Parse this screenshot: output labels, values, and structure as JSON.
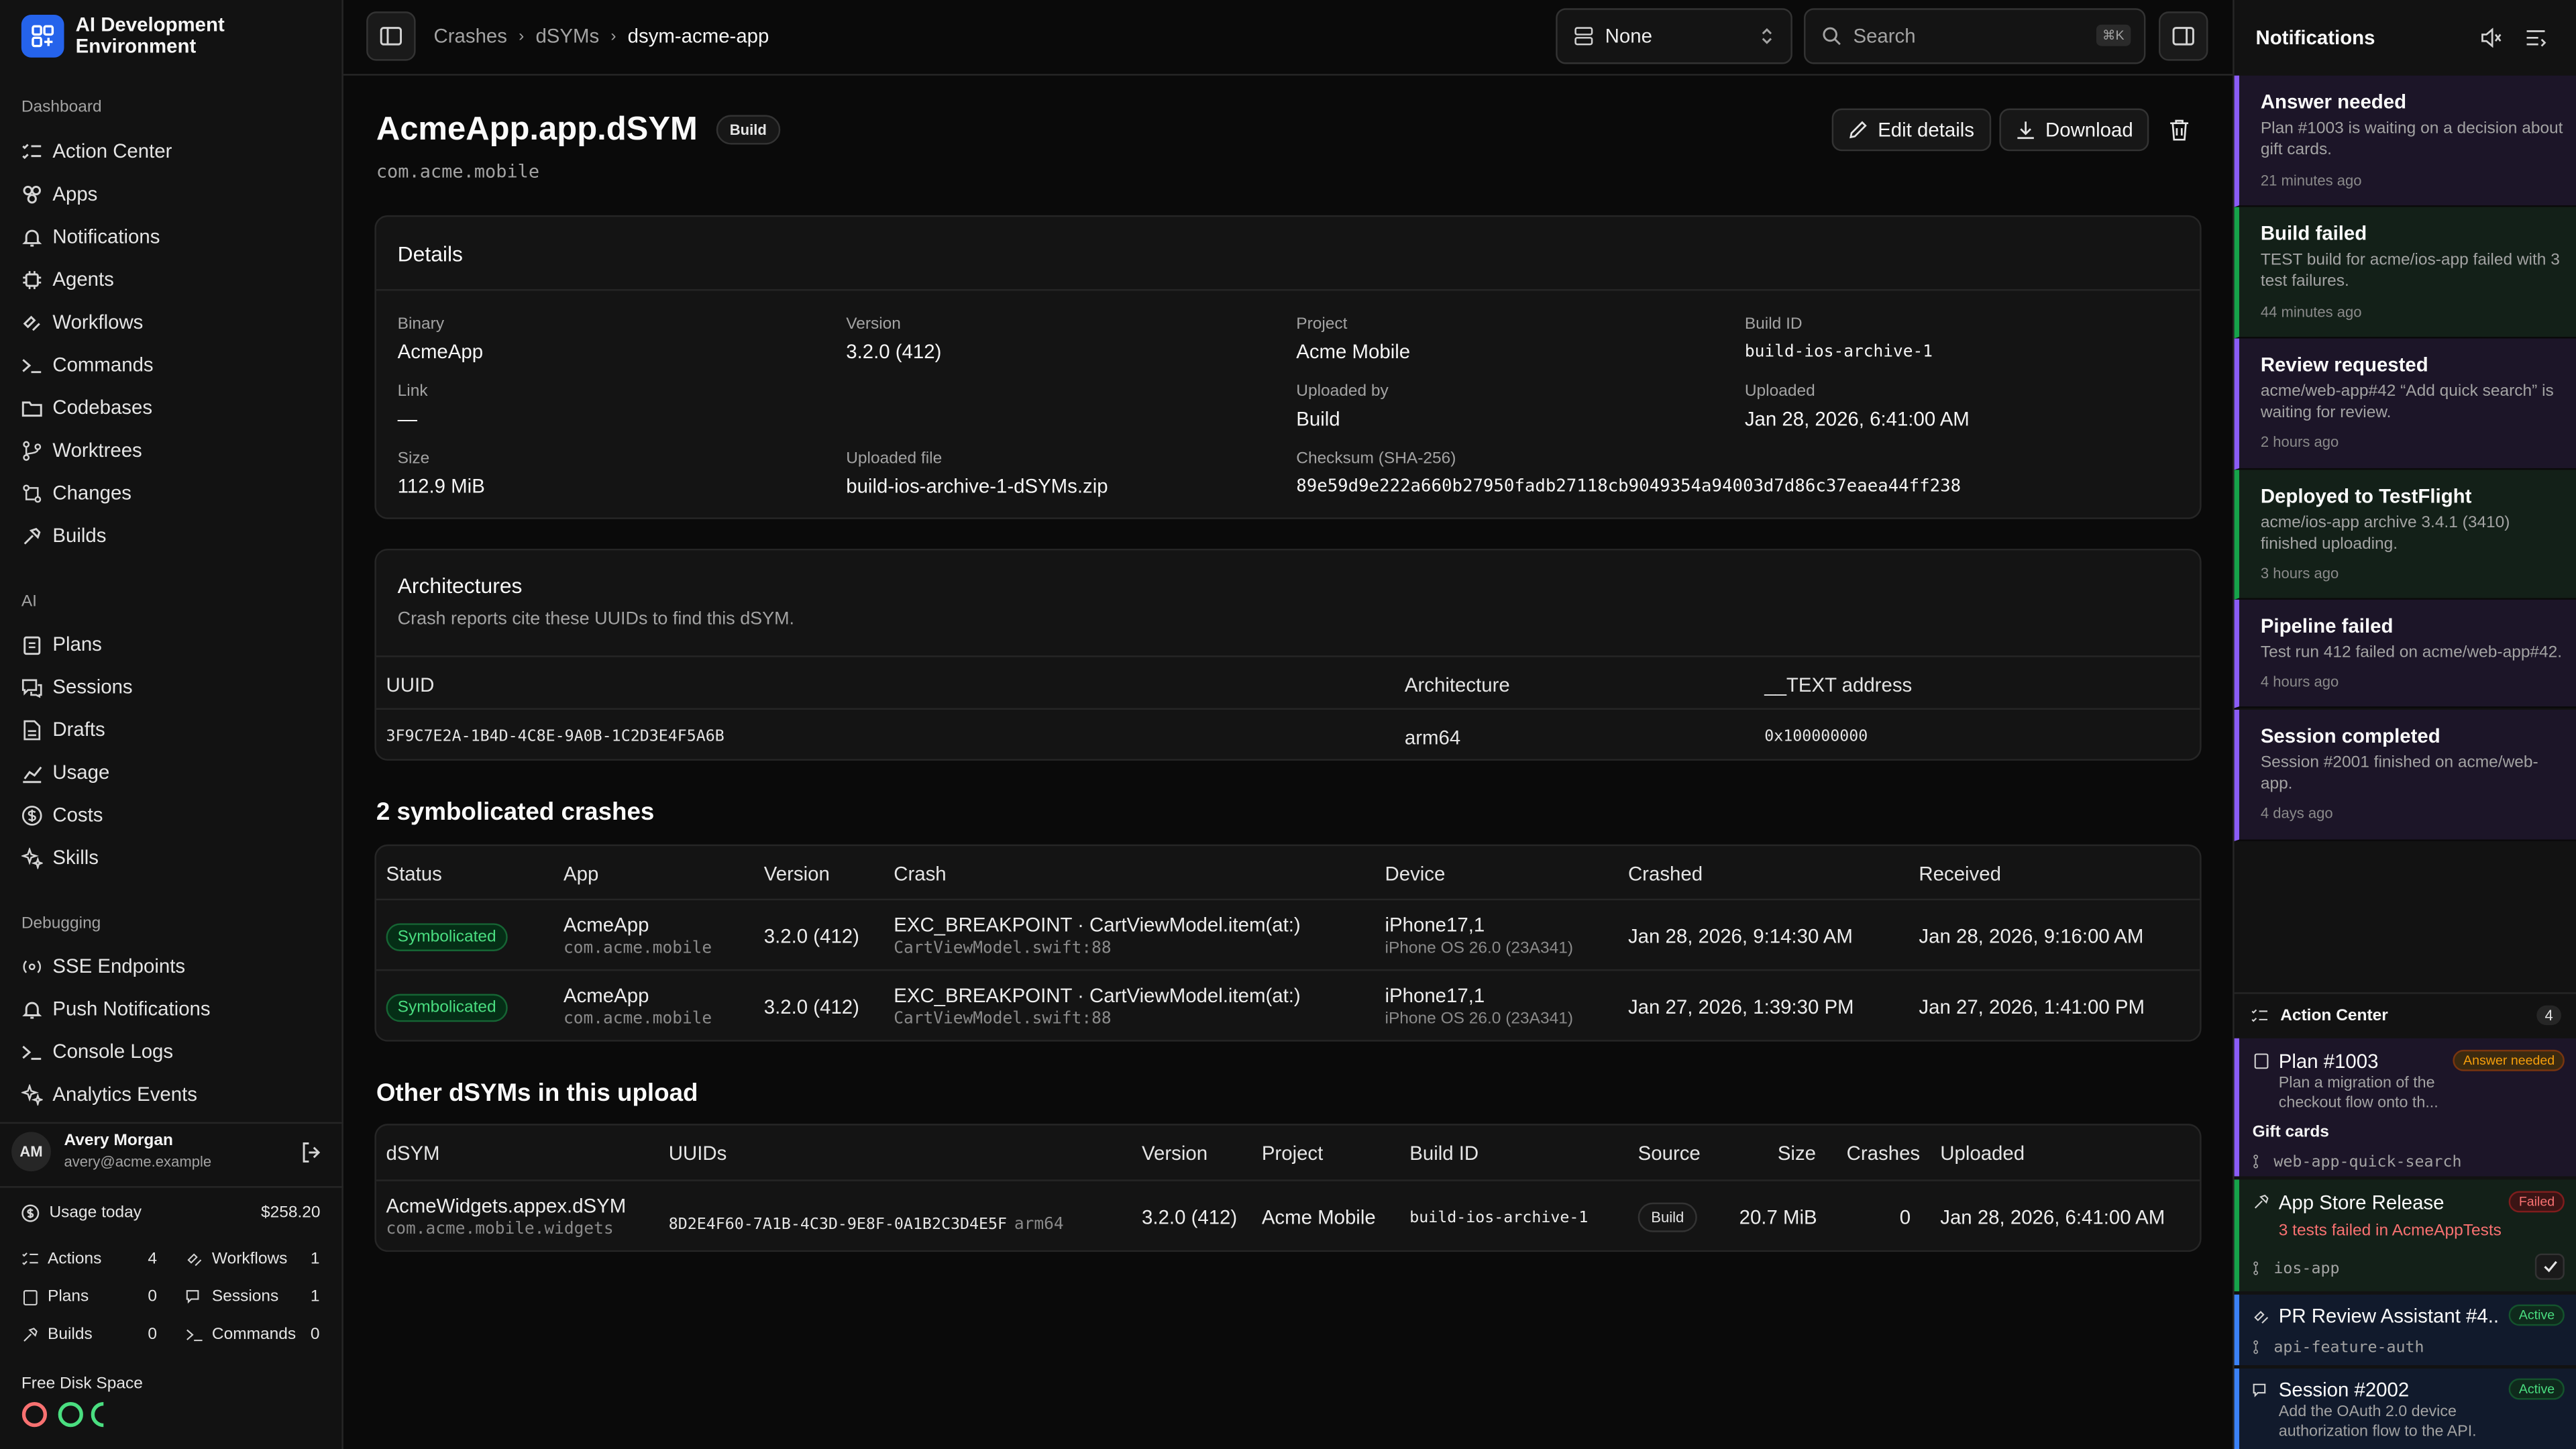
{
  "brand": {
    "line1": "AI Development",
    "line2": "Environment"
  },
  "sidebar": {
    "sections": {
      "dashboard": "Dashboard",
      "ai": "AI",
      "debugging": "Debugging"
    },
    "dashboard_items": [
      "Action Center",
      "Apps",
      "Notifications",
      "Agents",
      "Workflows",
      "Commands",
      "Codebases",
      "Worktrees",
      "Changes",
      "Builds"
    ],
    "ai_items": [
      "Plans",
      "Sessions",
      "Drafts",
      "Usage",
      "Costs",
      "Skills"
    ],
    "debug_items": [
      "SSE Endpoints",
      "Push Notifications",
      "Console Logs",
      "Analytics Events"
    ],
    "user": {
      "initials": "AM",
      "name": "Avery Morgan",
      "email": "avery@acme.example"
    },
    "usage": {
      "label": "Usage today",
      "value": "$258.20"
    },
    "stats": [
      {
        "label": "Actions",
        "value": "4"
      },
      {
        "label": "Workflows",
        "value": "1"
      },
      {
        "label": "Plans",
        "value": "0"
      },
      {
        "label": "Sessions",
        "value": "1"
      },
      {
        "label": "Builds",
        "value": "0"
      },
      {
        "label": "Commands",
        "value": "0"
      }
    ],
    "disk": {
      "label": "Free Disk Space"
    }
  },
  "header": {
    "breadcrumbs": [
      "Crashes",
      "dSYMs",
      "dsym-acme-app"
    ],
    "select_value": "None",
    "search_placeholder": "Search",
    "search_shortcut": "⌘K"
  },
  "page": {
    "title": "AcmeApp.app.dSYM",
    "badge": "Build",
    "subtitle": "com.acme.mobile",
    "edit_label": "Edit details",
    "download_label": "Download"
  },
  "details": {
    "heading": "Details",
    "binary_label": "Binary",
    "binary": "AcmeApp",
    "version_label": "Version",
    "version": "3.2.0 (412)",
    "project_label": "Project",
    "project": "Acme Mobile",
    "build_id_label": "Build ID",
    "build_id": "build-ios-archive-1",
    "link_label": "Link",
    "link": "—",
    "uploaded_by_label": "Uploaded by",
    "uploaded_by": "Build",
    "uploaded_label": "Uploaded",
    "uploaded": "Jan 28, 2026, 6:41:00 AM",
    "size_label": "Size",
    "size": "112.9 MiB",
    "file_label": "Uploaded file",
    "file": "build-ios-archive-1-dSYMs.zip",
    "checksum_label": "Checksum (SHA-256)",
    "checksum": "89e59d9e222a660b27950fadb27118cb9049354a94003d7d86c37eaea44ff238"
  },
  "architectures": {
    "heading": "Architectures",
    "description": "Crash reports cite these UUIDs to find this dSYM.",
    "columns": [
      "UUID",
      "Architecture",
      "__TEXT address"
    ],
    "row": {
      "uuid": "3F9C7E2A-1B4D-4C8E-9A0B-1C2D3E4F5A6B",
      "arch": "arm64",
      "address": "0x100000000"
    }
  },
  "crashes": {
    "heading": "2 symbolicated crashes",
    "columns": [
      "Status",
      "App",
      "Version",
      "Crash",
      "Device",
      "Crashed",
      "Received"
    ],
    "rows": [
      {
        "status": "Symbolicated",
        "app": "AcmeApp",
        "bundle": "com.acme.mobile",
        "version": "3.2.0 (412)",
        "crash": "EXC_BREAKPOINT · CartViewModel.item(at:)",
        "location": "CartViewModel.swift:88",
        "device": "iPhone17,1",
        "os": "iPhone OS 26.0 (23A341)",
        "crashed": "Jan 28, 2026, 9:14:30 AM",
        "received": "Jan 28, 2026, 9:16:00 AM"
      },
      {
        "status": "Symbolicated",
        "app": "AcmeApp",
        "bundle": "com.acme.mobile",
        "version": "3.2.0 (412)",
        "crash": "EXC_BREAKPOINT · CartViewModel.item(at:)",
        "location": "CartViewModel.swift:88",
        "device": "iPhone17,1",
        "os": "iPhone OS 26.0 (23A341)",
        "crashed": "Jan 27, 2026, 1:39:30 PM",
        "received": "Jan 27, 2026, 1:41:00 PM"
      }
    ]
  },
  "others": {
    "heading": "Other dSYMs in this upload",
    "columns": [
      "dSYM",
      "UUIDs",
      "Version",
      "Project",
      "Build ID",
      "Source",
      "Size",
      "Crashes",
      "Uploaded"
    ],
    "row": {
      "name": "AcmeWidgets.appex.dSYM",
      "bundle": "com.acme.mobile.widgets",
      "uuid": "8D2E4F60-7A1B-4C3D-9E8F-0A1B2C3D4E5F",
      "arch": "arm64",
      "version": "3.2.0 (412)",
      "project": "Acme Mobile",
      "build_id": "build-ios-archive-1",
      "source": "Build",
      "size": "20.7 MiB",
      "crashes": "0",
      "uploaded": "Jan 28, 2026, 6:41:00 AM"
    }
  },
  "notifications": {
    "title": "Notifications",
    "items": [
      {
        "title": "Answer needed",
        "body": "Plan #1003 is waiting on a decision about gift cards.",
        "time": "21 minutes ago",
        "color": "#8b5cf6"
      },
      {
        "title": "Build failed",
        "body": "TEST build for acme/ios-app failed with 3 test failures.",
        "time": "44 minutes ago",
        "color": "#16a34a"
      },
      {
        "title": "Review requested",
        "body": "acme/web-app#42 “Add quick search” is waiting for review.",
        "time": "2 hours ago",
        "color": "#8b5cf6"
      },
      {
        "title": "Deployed to TestFlight",
        "body": "acme/ios-app archive 3.4.1 (3410) finished uploading.",
        "time": "3 hours ago",
        "color": "#16a34a"
      },
      {
        "title": "Pipeline failed",
        "body": "Test run 412 failed on acme/web-app#42.",
        "time": "4 hours ago",
        "color": "#8b5cf6"
      },
      {
        "title": "Session completed",
        "body": "Session #2001 finished on acme/web-app.",
        "time": "4 days ago",
        "color": "#8b5cf6"
      }
    ]
  },
  "action_center": {
    "title": "Action Center",
    "count": "4",
    "items": [
      {
        "title": "Plan #1003",
        "tag": "Answer needed",
        "body": "Plan a migration of the checkout flow onto th...",
        "extra": "Gift cards",
        "branch": "web-app-quick-search"
      },
      {
        "title": "App Store Release",
        "tag": "Failed",
        "body": "3 tests failed in AcmeAppTests",
        "branch": "ios-app"
      },
      {
        "title": "PR Review Assistant #4...",
        "tag": "Active",
        "branch": "api-feature-auth"
      },
      {
        "title": "Session #2002",
        "tag": "Active",
        "body": "Add the OAuth 2.0 device authorization flow to the API."
      }
    ]
  }
}
